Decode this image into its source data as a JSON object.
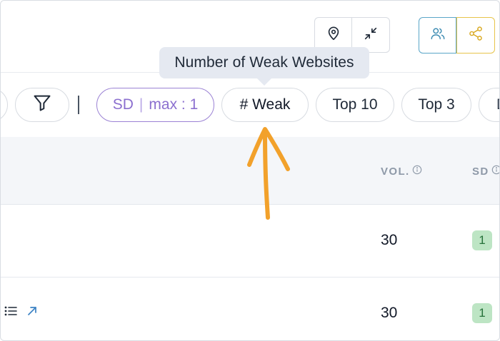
{
  "toolbar": {
    "location_icon": "map-pin-icon",
    "collapse_icon": "collapse-arrows-icon",
    "users_icon": "users-icon",
    "share_icon": "share-icon"
  },
  "tooltip": {
    "text": "Number of Weak Websites"
  },
  "filters": {
    "filter_icon": "funnel-icon",
    "divider": "|",
    "sd_chip": {
      "label": "SD",
      "separator": "|",
      "value": "max : 1"
    },
    "weak_chip": "# Weak",
    "top10_chip": "Top 10",
    "top3_chip": "Top 3",
    "cut_chip": "D"
  },
  "table": {
    "columns": {
      "vol": "VOL.",
      "sd": "SD"
    },
    "rows": [
      {
        "vol": "30",
        "sd": "1"
      },
      {
        "vol": "30",
        "sd": "1"
      }
    ]
  },
  "colors": {
    "accent_purple": "#8b6fcf",
    "users_border": "#5aa6c8",
    "share_border": "#e7c44a",
    "badge_green": "#bde5c4",
    "annotation_orange": "#f2a12b"
  }
}
